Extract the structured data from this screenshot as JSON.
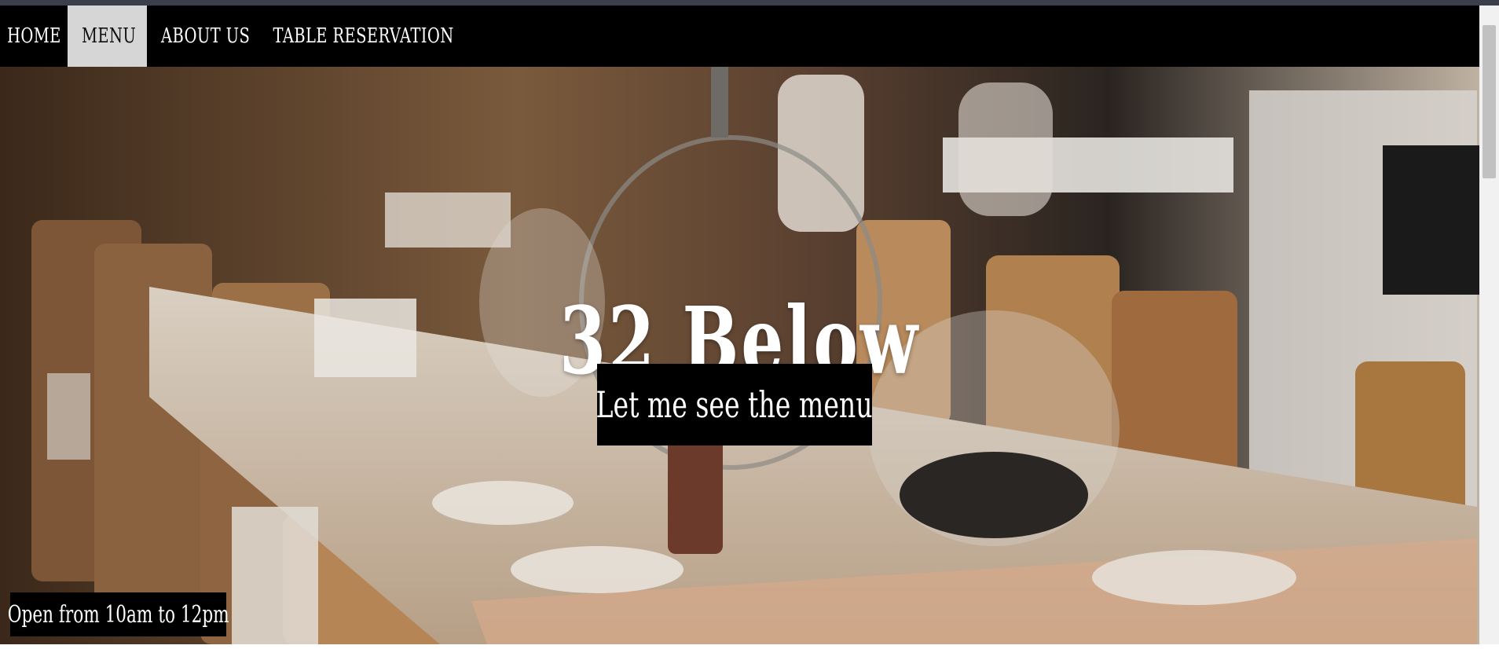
{
  "nav": {
    "items": [
      {
        "label": "HOME",
        "active": false
      },
      {
        "label": "MENU",
        "active": true
      },
      {
        "label": "ABOUT US",
        "active": false
      },
      {
        "label": "TABLE RESERVATION",
        "active": false
      }
    ]
  },
  "hero": {
    "title": "32 Below",
    "menu_button_label": "Let me see the menu",
    "hours_text": "Open from 10am to 12pm",
    "image_description_icon": "restaurant-table-photo"
  },
  "colors": {
    "navbar_bg": "#000000",
    "nav_active_bg": "#d6d6d6",
    "button_bg": "#000000",
    "text_light": "#ffffff"
  }
}
